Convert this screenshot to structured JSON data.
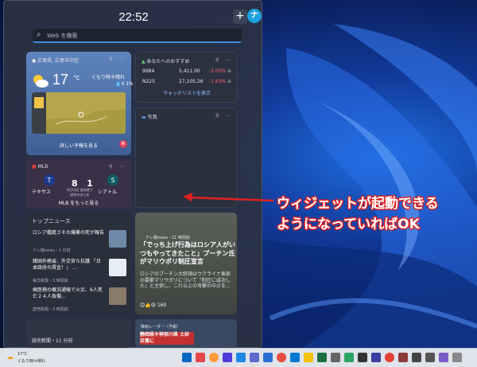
{
  "clock": "22:52",
  "header": {
    "add_label": "+",
    "avatar_initial": "ナ"
  },
  "search": {
    "placeholder": "Web を検索"
  },
  "weather": {
    "location": "広島県, 広島市中区",
    "temp": "17",
    "unit": "°C",
    "condition": "くもり時々晴れ",
    "rain": "4 1%",
    "more_label": "詳しい予報を見る",
    "badge": "新"
  },
  "stocks": {
    "header": "あなたへのおすすめ",
    "rows": [
      {
        "symbol": "9984",
        "price": "5,411.00",
        "change": "-3.05%"
      },
      {
        "symbol": "N225",
        "price": "27,105.26",
        "change": "-1.63%"
      }
    ],
    "watchlist_label": "ウォッチリストを表示"
  },
  "photos": {
    "header": "写真"
  },
  "mlb": {
    "header": "MLB",
    "team1": "テキサス",
    "team2": "シアトル",
    "score1": "8",
    "score2": "1",
    "info1": "4月13日 試合終了",
    "info2": "試合のまとめ",
    "more_label": "MLB をもっと見る"
  },
  "top_news": {
    "header": "トップニュース",
    "items": [
      {
        "title": "ロシア艦艇さその爆薬の死が報告",
        "meta": "テレ朝news・1 日前"
      },
      {
        "title": "韓国外務省、外交官ら抗議 「日本政府の賃金！」 ...",
        "meta": "毎日新聞・3 時間前"
      },
      {
        "title": "歯医務の概況通報で火災、6人死亡２４人負傷...",
        "meta": "読売新聞・3 時間前"
      }
    ]
  },
  "feature": {
    "source": "テレ朝news・21 時間前",
    "title": "「でっち上げ行為はロシア人がいつもやってきたこと」プーチン氏がマリウポリ制圧宣言",
    "body": "ロシアのプーチン大統領はウクライナ東部の要衝マリウポリについて「制圧に成功した」と主張し、これ以上の攻撃の中止を...",
    "reactions": "160"
  },
  "bottom": {
    "left_source": "読売新聞・11 分前",
    "right_title": "降雨レーダー（予報）",
    "right_alert": "静岡県や神奈川県 土砂災害に"
  },
  "annotation": {
    "line1": "ウィジェットが起動できる",
    "line2": "ようになっていればOK"
  },
  "taskbar": {
    "temp": "17°C",
    "condition": "くもり時々晴れ"
  }
}
